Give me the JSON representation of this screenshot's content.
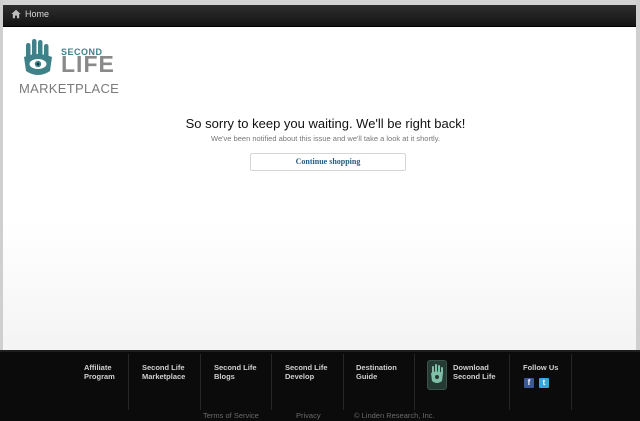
{
  "topbar": {
    "home_label": "Home"
  },
  "logo": {
    "second": "SECOND",
    "life": "LIFE",
    "marketplace": "MARKETPLACE"
  },
  "main": {
    "title": "So sorry to keep you waiting. We'll be right back!",
    "subtitle": "We've been notified about this issue and we'll take a look at it shortly.",
    "continue_label": "Continue shopping"
  },
  "footer": {
    "links": [
      {
        "line1": "Affiliate",
        "line2": "Program"
      },
      {
        "line1": "Second Life",
        "line2": "Marketplace"
      },
      {
        "line1": "Second Life",
        "line2": "Blogs"
      },
      {
        "line1": "Second Life",
        "line2": "Develop"
      },
      {
        "line1": "Destination",
        "line2": "Guide"
      },
      {
        "line1": "Download",
        "line2": "Second Life"
      }
    ],
    "follow_label": "Follow Us",
    "facebook_glyph": "f",
    "twitter_glyph": "t",
    "bottom": {
      "terms": "Terms of Service",
      "privacy": "Privacy",
      "copyright": "© Linden Research, Inc."
    }
  },
  "colors": {
    "topbar": "#1e1e1e",
    "footer": "#0b0b0b",
    "logo_teal": "#3e8189",
    "link_blue": "#2b5a7a",
    "facebook": "#3b5998",
    "twitter": "#2fa9e0"
  }
}
